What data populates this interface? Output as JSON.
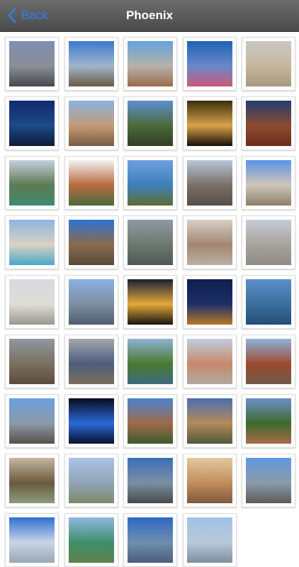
{
  "header": {
    "back_label": "Back",
    "title": "Phoenix"
  },
  "photos": [
    {
      "top": "#7d8fb3",
      "mid": "#8a8f97",
      "bottom": "#46484d"
    },
    {
      "top": "#3d7ad1",
      "mid": "#9fb5c8",
      "bottom": "#6b5a45"
    },
    {
      "top": "#64a3df",
      "mid": "#b6b2a8",
      "bottom": "#9a6b4c"
    },
    {
      "top": "#1d63b5",
      "mid": "#6a88c8",
      "bottom": "#c95a77"
    },
    {
      "top": "#c9c8c4",
      "mid": "#c7b79b",
      "bottom": "#a59a85"
    },
    {
      "top": "#0f2a6e",
      "mid": "#1e4a85",
      "bottom": "#0e1a38"
    },
    {
      "top": "#8bb2e0",
      "mid": "#c49b78",
      "bottom": "#7a5b42"
    },
    {
      "top": "#5d8fd0",
      "mid": "#4d6a3a",
      "bottom": "#2f3e24"
    },
    {
      "top": "#3a2e0d",
      "mid": "#d9a34b",
      "bottom": "#160f06"
    },
    {
      "top": "#243c72",
      "mid": "#8c4b30",
      "bottom": "#6b2c1b"
    },
    {
      "top": "#c6cfe0",
      "mid": "#5d7a52",
      "bottom": "#3f8a72"
    },
    {
      "top": "#f2f2f2",
      "mid": "#b96a3e",
      "bottom": "#4a6b3a"
    },
    {
      "top": "#6ea0de",
      "mid": "#3e7fb8",
      "bottom": "#5e6f34"
    },
    {
      "top": "#b9c6d9",
      "mid": "#7a6f66",
      "bottom": "#565049"
    },
    {
      "top": "#5b94e6",
      "mid": "#cfc6b8",
      "bottom": "#8e806a"
    },
    {
      "top": "#8cb5e3",
      "mid": "#d9d2c2",
      "bottom": "#4ba7c8"
    },
    {
      "top": "#2f75d0",
      "mid": "#8a6a4d",
      "bottom": "#5a4a3c"
    },
    {
      "top": "#8f9aa3",
      "mid": "#6c7770",
      "bottom": "#4e5a56"
    },
    {
      "top": "#d7cfc3",
      "mid": "#a38672",
      "bottom": "#b9b0a3"
    },
    {
      "top": "#c5cdd7",
      "mid": "#a8a39b",
      "bottom": "#8e8c88"
    },
    {
      "top": "#d6d9df",
      "mid": "#e0ddd5",
      "bottom": "#9b9893"
    },
    {
      "top": "#8ab1e2",
      "mid": "#7e8ea3",
      "bottom": "#4e5d6d"
    },
    {
      "top": "#1b1e35",
      "mid": "#e4a93a",
      "bottom": "#161512"
    },
    {
      "top": "#0d1e4f",
      "mid": "#1e2f67",
      "bottom": "#b57a28"
    },
    {
      "top": "#5b8fc9",
      "mid": "#3d6f9c",
      "bottom": "#234d76"
    },
    {
      "top": "#8f98a2",
      "mid": "#7a7060",
      "bottom": "#5a4d3a"
    },
    {
      "top": "#a5a7af",
      "mid": "#4c5d7d",
      "bottom": "#7d6e5e"
    },
    {
      "top": "#8fb2d8",
      "mid": "#4a7a2f",
      "bottom": "#3f6a7e"
    },
    {
      "top": "#c2cde0",
      "mid": "#c58a6a",
      "bottom": "#b3a7a3"
    },
    {
      "top": "#8fb2dd",
      "mid": "#9c4a2f",
      "bottom": "#6f5a47"
    },
    {
      "top": "#6d9fe0",
      "mid": "#8c9aa8",
      "bottom": "#56514a"
    },
    {
      "top": "#070b1e",
      "mid": "#2a6ad8",
      "bottom": "#0a0f2c"
    },
    {
      "top": "#4f83cf",
      "mid": "#9d6b4b",
      "bottom": "#3b5b2c"
    },
    {
      "top": "#4a6fae",
      "mid": "#b48a5a",
      "bottom": "#4f5a3a"
    },
    {
      "top": "#6b8fc9",
      "mid": "#3e6a2c",
      "bottom": "#aa6a4a"
    },
    {
      "top": "#c4b8a3",
      "mid": "#6a5a3c",
      "bottom": "#8b9b7c"
    },
    {
      "top": "#a9c4e4",
      "mid": "#93a4b8",
      "bottom": "#7c8a6a"
    },
    {
      "top": "#3c6eb8",
      "mid": "#7a8fa4",
      "bottom": "#4a4a4a"
    },
    {
      "top": "#e2c9a0",
      "mid": "#c28d5c",
      "bottom": "#7d5b42"
    },
    {
      "top": "#5f99e0",
      "mid": "#8a9aa8",
      "bottom": "#5c5c5c"
    },
    {
      "top": "#2f6fd0",
      "mid": "#c9d5e5",
      "bottom": "#9aa6b8"
    },
    {
      "top": "#8fb7e2",
      "mid": "#3f8f6a",
      "bottom": "#5f7f4a"
    },
    {
      "top": "#2e68c4",
      "mid": "#6f8fae",
      "bottom": "#4a5f7a"
    },
    {
      "top": "#9fc1e8",
      "mid": "#b9c9d8",
      "bottom": "#7f8f9f"
    }
  ]
}
